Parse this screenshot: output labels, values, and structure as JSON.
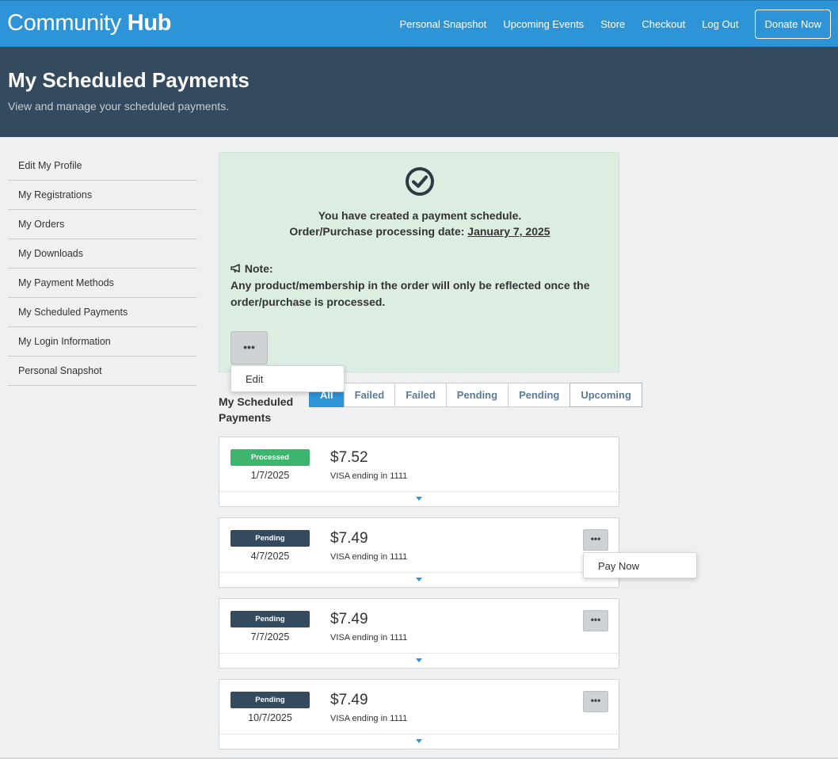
{
  "header": {
    "brand_light": "Community",
    "brand_bold": "Hub",
    "nav": [
      "Personal Snapshot",
      "Upcoming Events",
      "Store",
      "Checkout",
      "Log Out"
    ],
    "donate_label": "Donate Now"
  },
  "hero": {
    "title": "My Scheduled Payments",
    "subtitle": "View and manage your scheduled payments."
  },
  "sidebar": {
    "items": [
      {
        "label": "Edit My Profile"
      },
      {
        "label": "My Registrations"
      },
      {
        "label": "My Orders"
      },
      {
        "label": "My Downloads"
      },
      {
        "label": "My Payment Methods"
      },
      {
        "label": "My Scheduled Payments"
      },
      {
        "label": "My Login Information"
      },
      {
        "label": "Personal Snapshot"
      }
    ]
  },
  "success": {
    "line1": "You have created a payment schedule.",
    "line2_prefix": "Order/Purchase processing date: ",
    "date": "January 7, 2025",
    "note_title": "Note:",
    "note_text": "Any product/membership in the order will only be reflected once the order/purchase is processed.",
    "menu_label": "•••",
    "menu_option": "Edit"
  },
  "schedule": {
    "label": "My Scheduled Payments",
    "filters": [
      "All",
      "Failed",
      "Failed",
      "Pending",
      "Pending",
      "Upcoming"
    ],
    "active_filter": "All"
  },
  "payments": [
    {
      "status": "Processed",
      "date": "1/7/2025",
      "amount": "$7.52",
      "method": "VISA ending in 1111"
    },
    {
      "status": "Pending",
      "date": "4/7/2025",
      "amount": "$7.49",
      "method": "VISA ending in 1111"
    },
    {
      "status": "Pending",
      "date": "7/7/2025",
      "amount": "$7.49",
      "method": "VISA ending in 1111"
    },
    {
      "status": "Pending",
      "date": "10/7/2025",
      "amount": "$7.49",
      "method": "VISA ending in 1111"
    }
  ],
  "card_menu_label": "•••",
  "pay_now_label": "Pay Now",
  "colors": {
    "primary": "#2e94d8",
    "hero": "#344a5f",
    "processed": "#3db56e",
    "pending": "#344a5f",
    "success_bg": "#dcede2"
  }
}
